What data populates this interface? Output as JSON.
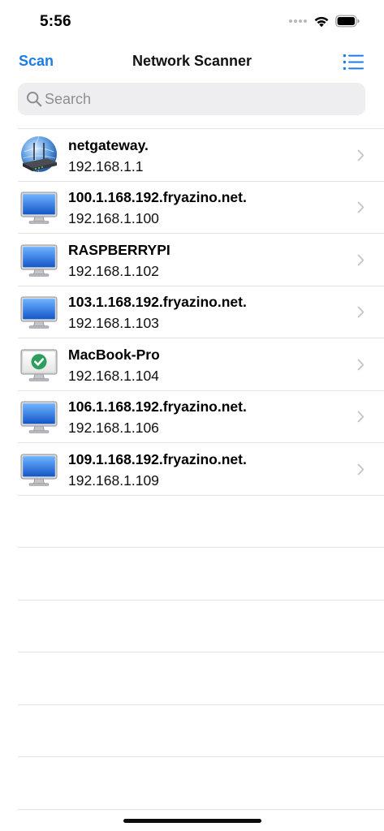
{
  "status_bar": {
    "time": "5:56",
    "icons": [
      "signal-dots-icon",
      "wifi-icon",
      "battery-icon"
    ]
  },
  "nav": {
    "left_button": "Scan",
    "title": "Network Scanner",
    "right_icon": "list-icon",
    "accent_color": "#1a7de8"
  },
  "search": {
    "placeholder": "Search",
    "value": ""
  },
  "devices": [
    {
      "name": "netgateway.",
      "ip": "192.168.1.1",
      "icon": "router-globe-icon"
    },
    {
      "name": "100.1.168.192.fryazino.net.",
      "ip": "192.168.1.100",
      "icon": "monitor-icon"
    },
    {
      "name": "RASPBERRYPI",
      "ip": "192.168.1.102",
      "icon": "monitor-icon"
    },
    {
      "name": "103.1.168.192.fryazino.net.",
      "ip": "192.168.1.103",
      "icon": "monitor-icon"
    },
    {
      "name": "MacBook-Pro",
      "ip": "192.168.1.104",
      "icon": "monitor-checkmark-icon"
    },
    {
      "name": "106.1.168.192.fryazino.net.",
      "ip": "192.168.1.106",
      "icon": "monitor-icon"
    },
    {
      "name": "109.1.168.192.fryazino.net.",
      "ip": "192.168.1.109",
      "icon": "monitor-icon"
    }
  ]
}
